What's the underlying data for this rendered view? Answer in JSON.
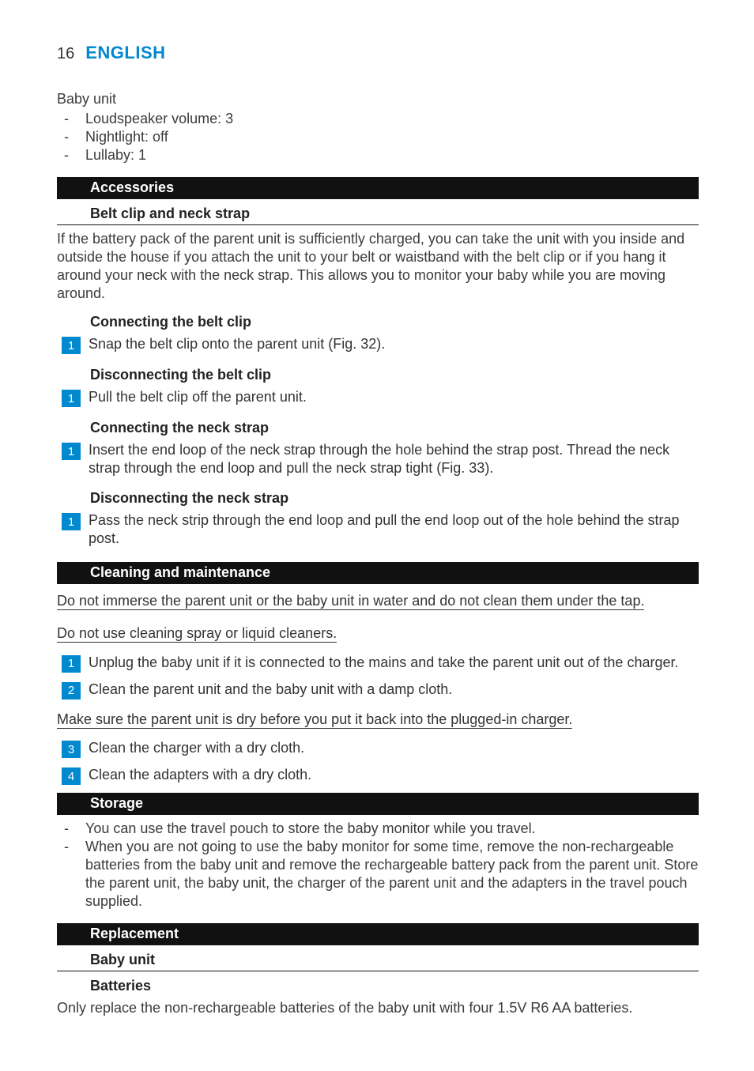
{
  "header": {
    "page_number": "16",
    "language": "ENGLISH"
  },
  "intro": {
    "subtitle": "Baby unit",
    "items": [
      "Loudspeaker volume: 3",
      "Nightlight: off",
      "Lullaby: 1"
    ]
  },
  "accessories": {
    "title": "Accessories",
    "belt_neck_title": "Belt clip and neck strap",
    "belt_neck_para": "If the battery pack of the parent unit is sufficiently charged, you can take the unit with you inside and outside the house if you attach the unit to your belt or waistband with the belt clip or if you hang it around your neck with the neck strap. This allows you to monitor your baby while you are moving around.",
    "connect_belt_title": "Connecting the belt clip",
    "connect_belt_step1": "Snap the belt clip onto the parent unit (Fig. 32).",
    "disconnect_belt_title": "Disconnecting the belt clip",
    "disconnect_belt_step1": "Pull the belt clip off the parent unit.",
    "connect_neck_title": "Connecting the neck strap",
    "connect_neck_step1": "Insert the end loop of the neck strap through the hole behind the strap post. Thread the neck strap through the end loop and pull the neck strap tight (Fig. 33).",
    "disconnect_neck_title": "Disconnecting the neck strap",
    "disconnect_neck_step1": "Pass the neck strip through the end loop and pull the end loop out of the hole behind the strap post."
  },
  "cleaning": {
    "title": "Cleaning and maintenance",
    "warn1": "Do not immerse the parent unit or the baby unit in water and do not clean them under the tap.",
    "warn2": "Do not use cleaning spray or liquid cleaners.",
    "step1": "Unplug the baby unit if it is connected to the mains and take the parent unit out of the charger.",
    "step2": "Clean the parent unit and the baby unit with a damp cloth.",
    "warn3": "Make sure the parent unit is dry before you put it back into the plugged-in charger.",
    "step3": "Clean the charger with a dry cloth.",
    "step4": "Clean the adapters with a dry cloth."
  },
  "storage": {
    "title": "Storage",
    "items": [
      "You can use the travel pouch to store the baby monitor while you travel.",
      "When you are not going to use the baby monitor for some time, remove the non-rechargeable batteries from the baby unit and remove the rechargeable battery pack from the parent unit. Store the parent unit, the baby unit, the charger of the parent unit and the adapters in the travel pouch supplied."
    ]
  },
  "replacement": {
    "title": "Replacement",
    "baby_unit_title": "Baby unit",
    "batteries_title": "Batteries",
    "batteries_para": "Only replace the non-rechargeable batteries of the baby unit with four 1.5V R6 AA batteries."
  },
  "nums": {
    "n1": "1",
    "n2": "2",
    "n3": "3",
    "n4": "4"
  }
}
